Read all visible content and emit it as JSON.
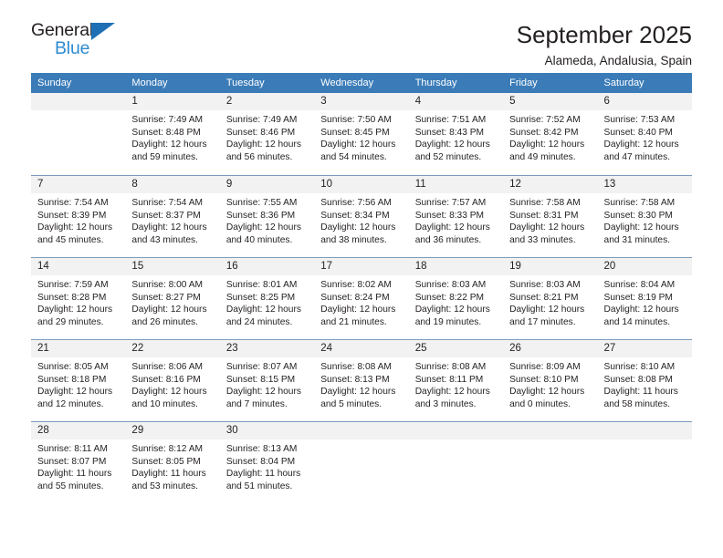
{
  "logo": {
    "word_one": "General",
    "word_two": "Blue",
    "triangle_color": "#1f6fb5",
    "blue_text_color": "#2e8bd0"
  },
  "header": {
    "title": "September 2025",
    "subtitle": "Alameda, Andalusia, Spain"
  },
  "theme": {
    "header_row_bg": "#3b7cb8",
    "header_row_text": "#ffffff",
    "daynum_bg": "#f2f2f2",
    "row_rule": "#7c9cbd",
    "body_text": "#231f20"
  },
  "calendar": {
    "weekday_headers": [
      "Sunday",
      "Monday",
      "Tuesday",
      "Wednesday",
      "Thursday",
      "Friday",
      "Saturday"
    ],
    "weeks": [
      [
        {
          "day": "",
          "sunrise": "",
          "sunset": "",
          "daylight_line1": "",
          "daylight_line2": ""
        },
        {
          "day": "1",
          "sunrise": "Sunrise: 7:49 AM",
          "sunset": "Sunset: 8:48 PM",
          "daylight_line1": "Daylight: 12 hours",
          "daylight_line2": "and 59 minutes."
        },
        {
          "day": "2",
          "sunrise": "Sunrise: 7:49 AM",
          "sunset": "Sunset: 8:46 PM",
          "daylight_line1": "Daylight: 12 hours",
          "daylight_line2": "and 56 minutes."
        },
        {
          "day": "3",
          "sunrise": "Sunrise: 7:50 AM",
          "sunset": "Sunset: 8:45 PM",
          "daylight_line1": "Daylight: 12 hours",
          "daylight_line2": "and 54 minutes."
        },
        {
          "day": "4",
          "sunrise": "Sunrise: 7:51 AM",
          "sunset": "Sunset: 8:43 PM",
          "daylight_line1": "Daylight: 12 hours",
          "daylight_line2": "and 52 minutes."
        },
        {
          "day": "5",
          "sunrise": "Sunrise: 7:52 AM",
          "sunset": "Sunset: 8:42 PM",
          "daylight_line1": "Daylight: 12 hours",
          "daylight_line2": "and 49 minutes."
        },
        {
          "day": "6",
          "sunrise": "Sunrise: 7:53 AM",
          "sunset": "Sunset: 8:40 PM",
          "daylight_line1": "Daylight: 12 hours",
          "daylight_line2": "and 47 minutes."
        }
      ],
      [
        {
          "day": "7",
          "sunrise": "Sunrise: 7:54 AM",
          "sunset": "Sunset: 8:39 PM",
          "daylight_line1": "Daylight: 12 hours",
          "daylight_line2": "and 45 minutes."
        },
        {
          "day": "8",
          "sunrise": "Sunrise: 7:54 AM",
          "sunset": "Sunset: 8:37 PM",
          "daylight_line1": "Daylight: 12 hours",
          "daylight_line2": "and 43 minutes."
        },
        {
          "day": "9",
          "sunrise": "Sunrise: 7:55 AM",
          "sunset": "Sunset: 8:36 PM",
          "daylight_line1": "Daylight: 12 hours",
          "daylight_line2": "and 40 minutes."
        },
        {
          "day": "10",
          "sunrise": "Sunrise: 7:56 AM",
          "sunset": "Sunset: 8:34 PM",
          "daylight_line1": "Daylight: 12 hours",
          "daylight_line2": "and 38 minutes."
        },
        {
          "day": "11",
          "sunrise": "Sunrise: 7:57 AM",
          "sunset": "Sunset: 8:33 PM",
          "daylight_line1": "Daylight: 12 hours",
          "daylight_line2": "and 36 minutes."
        },
        {
          "day": "12",
          "sunrise": "Sunrise: 7:58 AM",
          "sunset": "Sunset: 8:31 PM",
          "daylight_line1": "Daylight: 12 hours",
          "daylight_line2": "and 33 minutes."
        },
        {
          "day": "13",
          "sunrise": "Sunrise: 7:58 AM",
          "sunset": "Sunset: 8:30 PM",
          "daylight_line1": "Daylight: 12 hours",
          "daylight_line2": "and 31 minutes."
        }
      ],
      [
        {
          "day": "14",
          "sunrise": "Sunrise: 7:59 AM",
          "sunset": "Sunset: 8:28 PM",
          "daylight_line1": "Daylight: 12 hours",
          "daylight_line2": "and 29 minutes."
        },
        {
          "day": "15",
          "sunrise": "Sunrise: 8:00 AM",
          "sunset": "Sunset: 8:27 PM",
          "daylight_line1": "Daylight: 12 hours",
          "daylight_line2": "and 26 minutes."
        },
        {
          "day": "16",
          "sunrise": "Sunrise: 8:01 AM",
          "sunset": "Sunset: 8:25 PM",
          "daylight_line1": "Daylight: 12 hours",
          "daylight_line2": "and 24 minutes."
        },
        {
          "day": "17",
          "sunrise": "Sunrise: 8:02 AM",
          "sunset": "Sunset: 8:24 PM",
          "daylight_line1": "Daylight: 12 hours",
          "daylight_line2": "and 21 minutes."
        },
        {
          "day": "18",
          "sunrise": "Sunrise: 8:03 AM",
          "sunset": "Sunset: 8:22 PM",
          "daylight_line1": "Daylight: 12 hours",
          "daylight_line2": "and 19 minutes."
        },
        {
          "day": "19",
          "sunrise": "Sunrise: 8:03 AM",
          "sunset": "Sunset: 8:21 PM",
          "daylight_line1": "Daylight: 12 hours",
          "daylight_line2": "and 17 minutes."
        },
        {
          "day": "20",
          "sunrise": "Sunrise: 8:04 AM",
          "sunset": "Sunset: 8:19 PM",
          "daylight_line1": "Daylight: 12 hours",
          "daylight_line2": "and 14 minutes."
        }
      ],
      [
        {
          "day": "21",
          "sunrise": "Sunrise: 8:05 AM",
          "sunset": "Sunset: 8:18 PM",
          "daylight_line1": "Daylight: 12 hours",
          "daylight_line2": "and 12 minutes."
        },
        {
          "day": "22",
          "sunrise": "Sunrise: 8:06 AM",
          "sunset": "Sunset: 8:16 PM",
          "daylight_line1": "Daylight: 12 hours",
          "daylight_line2": "and 10 minutes."
        },
        {
          "day": "23",
          "sunrise": "Sunrise: 8:07 AM",
          "sunset": "Sunset: 8:15 PM",
          "daylight_line1": "Daylight: 12 hours",
          "daylight_line2": "and 7 minutes."
        },
        {
          "day": "24",
          "sunrise": "Sunrise: 8:08 AM",
          "sunset": "Sunset: 8:13 PM",
          "daylight_line1": "Daylight: 12 hours",
          "daylight_line2": "and 5 minutes."
        },
        {
          "day": "25",
          "sunrise": "Sunrise: 8:08 AM",
          "sunset": "Sunset: 8:11 PM",
          "daylight_line1": "Daylight: 12 hours",
          "daylight_line2": "and 3 minutes."
        },
        {
          "day": "26",
          "sunrise": "Sunrise: 8:09 AM",
          "sunset": "Sunset: 8:10 PM",
          "daylight_line1": "Daylight: 12 hours",
          "daylight_line2": "and 0 minutes."
        },
        {
          "day": "27",
          "sunrise": "Sunrise: 8:10 AM",
          "sunset": "Sunset: 8:08 PM",
          "daylight_line1": "Daylight: 11 hours",
          "daylight_line2": "and 58 minutes."
        }
      ],
      [
        {
          "day": "28",
          "sunrise": "Sunrise: 8:11 AM",
          "sunset": "Sunset: 8:07 PM",
          "daylight_line1": "Daylight: 11 hours",
          "daylight_line2": "and 55 minutes."
        },
        {
          "day": "29",
          "sunrise": "Sunrise: 8:12 AM",
          "sunset": "Sunset: 8:05 PM",
          "daylight_line1": "Daylight: 11 hours",
          "daylight_line2": "and 53 minutes."
        },
        {
          "day": "30",
          "sunrise": "Sunrise: 8:13 AM",
          "sunset": "Sunset: 8:04 PM",
          "daylight_line1": "Daylight: 11 hours",
          "daylight_line2": "and 51 minutes."
        },
        {
          "day": "",
          "sunrise": "",
          "sunset": "",
          "daylight_line1": "",
          "daylight_line2": ""
        },
        {
          "day": "",
          "sunrise": "",
          "sunset": "",
          "daylight_line1": "",
          "daylight_line2": ""
        },
        {
          "day": "",
          "sunrise": "",
          "sunset": "",
          "daylight_line1": "",
          "daylight_line2": ""
        },
        {
          "day": "",
          "sunrise": "",
          "sunset": "",
          "daylight_line1": "",
          "daylight_line2": ""
        }
      ]
    ]
  }
}
